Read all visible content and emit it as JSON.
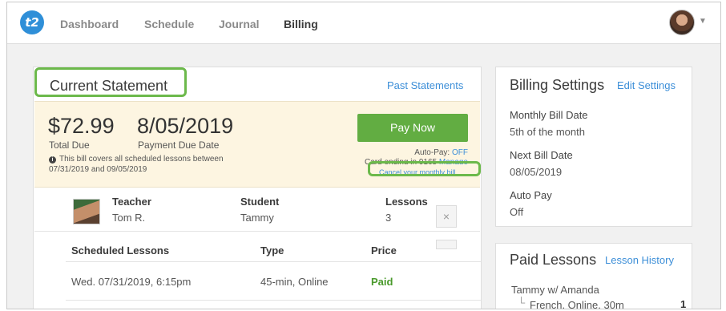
{
  "nav": {
    "logo_text": "t2",
    "items": [
      "Dashboard",
      "Schedule",
      "Journal",
      "Billing"
    ],
    "active": "Billing"
  },
  "statement": {
    "title": "Current Statement",
    "past_link": "Past Statements",
    "total_amount": "$72.99",
    "total_label": "Total Due",
    "due_date": "8/05/2019",
    "due_label": "Payment Due Date",
    "coverage_line1": "This bill covers all scheduled lessons between",
    "coverage_line2": "07/31/2019 and 09/05/2019",
    "pay_button": "Pay Now",
    "autopay_label": "Auto-Pay:",
    "autopay_value": "OFF",
    "card_text": "Card ending in 9165",
    "manage_link": "Manage",
    "cancel_link": "Cancel your monthly bill"
  },
  "lesson_summary": {
    "teacher_header": "Teacher",
    "teacher_name": "Tom R.",
    "student_header": "Student",
    "student_name": "Tammy",
    "lessons_header": "Lessons",
    "lessons_count": "3"
  },
  "scheduled": {
    "headers": [
      "Scheduled Lessons",
      "Type",
      "Price"
    ],
    "rows": [
      {
        "date": "Wed. 07/31/2019, 6:15pm",
        "type": "45-min, Online",
        "price": "Paid",
        "remove": "×"
      }
    ]
  },
  "billing_settings": {
    "title": "Billing Settings",
    "edit_link": "Edit Settings",
    "items": [
      {
        "label": "Monthly Bill Date",
        "value": "5th of the month"
      },
      {
        "label": "Next Bill Date",
        "value": "08/05/2019"
      },
      {
        "label": "Auto Pay",
        "value": "Off"
      }
    ]
  },
  "paid_lessons": {
    "title": "Paid Lessons",
    "history_link": "Lesson History",
    "entry": "Tammy w/ Amanda",
    "sub_entry": "French, Online, 30m",
    "count": "1"
  },
  "colors": {
    "accent_blue": "#3d8fd8",
    "pay_green": "#62ad42",
    "highlight_green": "#6cb94b",
    "statement_band": "#fdf5e1"
  }
}
